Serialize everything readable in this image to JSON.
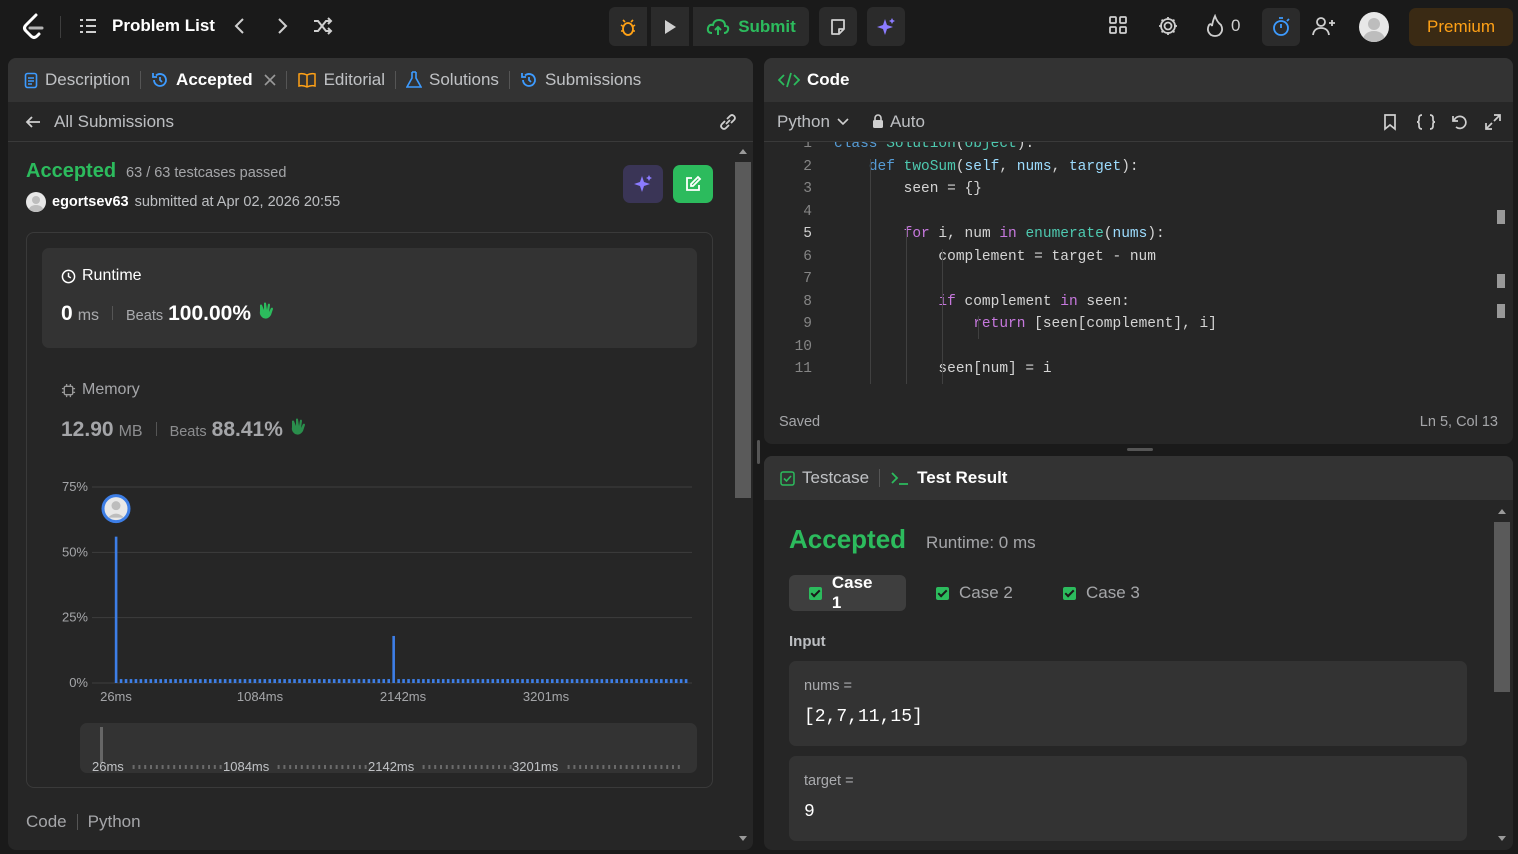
{
  "topbar": {
    "problem_list": "Problem List",
    "submit": "Submit",
    "streak": "0",
    "premium": "Premium"
  },
  "left_tabs": {
    "description": "Description",
    "accepted": "Accepted",
    "editorial": "Editorial",
    "solutions": "Solutions",
    "submissions": "Submissions"
  },
  "all_submissions": "All Submissions",
  "result": {
    "status": "Accepted",
    "testcases": "63 / 63 testcases passed",
    "user": "egortsev63",
    "submitted": "submitted at Apr 02, 2026 20:55"
  },
  "runtime": {
    "label": "Runtime",
    "value": "0",
    "unit": "ms",
    "beats_label": "Beats",
    "beats": "100.00%"
  },
  "memory": {
    "label": "Memory",
    "value": "12.90",
    "unit": "MB",
    "beats_label": "Beats",
    "beats": "88.41%"
  },
  "chart_data": {
    "type": "bar",
    "y_ticks": [
      "75%",
      "50%",
      "25%",
      "0%"
    ],
    "x_ticks": [
      "26ms",
      "1084ms",
      "2142ms",
      "3201ms"
    ],
    "ylim": [
      0,
      75
    ],
    "series": [
      {
        "values": [
          56,
          1.5,
          1.5,
          1.5,
          1.5,
          1.5,
          1.5,
          1.5,
          1.5,
          1.5,
          1.5,
          1.5,
          1.5,
          1.5,
          1.5,
          1.5,
          1.5,
          1.5,
          1.5,
          1.5,
          1.5,
          1.5,
          1.5,
          1.5,
          1.5,
          1.5,
          1.5,
          1.5,
          1.5,
          1.5,
          1.5,
          1.5,
          1.5,
          1.5,
          1.5,
          1.5,
          1.5,
          1.5,
          1.5,
          1.5,
          1.5,
          1.5,
          1.5,
          1.5,
          1.5,
          1.5,
          1.5,
          1.5,
          1.5,
          1.5,
          1.5,
          1.5,
          1.5,
          1.5,
          1.5,
          1.5,
          1.5,
          1.5,
          1.5,
          1.5,
          1.5,
          1.5,
          1.5,
          1.5,
          1.5,
          1.5,
          1.5,
          1.5,
          1.5,
          1.5,
          1.5,
          1.5,
          1.5,
          1.5,
          1.5,
          1.5,
          1.5,
          1.5,
          1.5,
          1.5,
          1.5,
          1.5,
          1.5,
          1.5,
          1.5,
          1.5,
          1.5,
          1.5,
          1.5,
          1.5,
          1.5,
          1.5,
          1.5,
          1.5,
          1.5,
          1.5,
          1.5,
          1.5,
          1.5,
          1.5,
          1.5,
          1.5,
          1.5,
          1.5,
          1.5,
          1.5,
          1.5,
          1.5,
          1.5,
          1.5,
          1.5,
          1.5,
          1.5,
          1.5,
          1.5,
          1.5
        ]
      }
    ],
    "peak_index_2": 56,
    "peak_value_2": 18,
    "grid": true
  },
  "range_ticks": [
    "26ms",
    "1084ms",
    "2142ms",
    "3201ms"
  ],
  "code_section": {
    "label": "Code",
    "lang": "Python"
  },
  "editor": {
    "title": "Code",
    "lang": "Python",
    "auto": "Auto",
    "saved": "Saved",
    "cursor": "Ln 5, Col 13",
    "lines": [
      "class Solution(object):",
      "    def twoSum(self, nums, target):",
      "        seen = {}",
      "",
      "        for i, num in enumerate(nums):",
      "            complement = target - num",
      "",
      "            if complement in seen:",
      "                return [seen[complement], i]",
      "",
      "            seen[num] = i"
    ]
  },
  "testpanel": {
    "testcase_tab": "Testcase",
    "result_tab": "Test Result",
    "status": "Accepted",
    "runtime": "Runtime: 0 ms",
    "cases": [
      "Case 1",
      "Case 2",
      "Case 3"
    ],
    "input_label": "Input",
    "inputs": [
      {
        "name": "nums =",
        "value": "[2,7,11,15]"
      },
      {
        "name": "target =",
        "value": "9"
      }
    ]
  }
}
